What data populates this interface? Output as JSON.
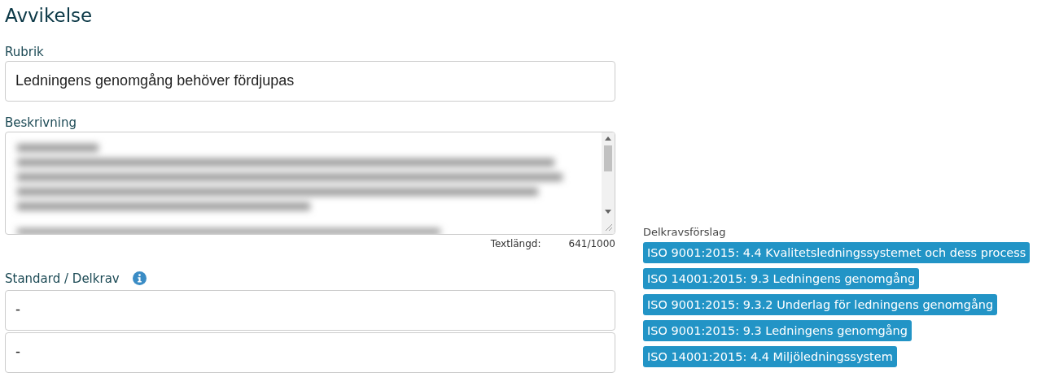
{
  "heading": "Avvikelse",
  "rubrik": {
    "label": "Rubrik",
    "value": "Ledningens genomgång behöver fördjupas"
  },
  "beskrivning": {
    "label": "Beskrivning",
    "counter_label": "Textlängd:",
    "counter": "641/1000"
  },
  "standard": {
    "label": "Standard / Delkrav",
    "fields": [
      "-",
      "-"
    ]
  },
  "suggestions": {
    "label": "Delkravsförslag",
    "tags": [
      "ISO 9001:2015: 4.4 Kvalitetsledningssystemet och dess process",
      "ISO 14001:2015: 9.3 Ledningens genomgång",
      "ISO 9001:2015: 9.3.2 Underlag för ledningens genomgång",
      "ISO 9001:2015: 9.3 Ledningens genomgång",
      "ISO 14001:2015: 4.4 Miljöledningssystem"
    ]
  }
}
